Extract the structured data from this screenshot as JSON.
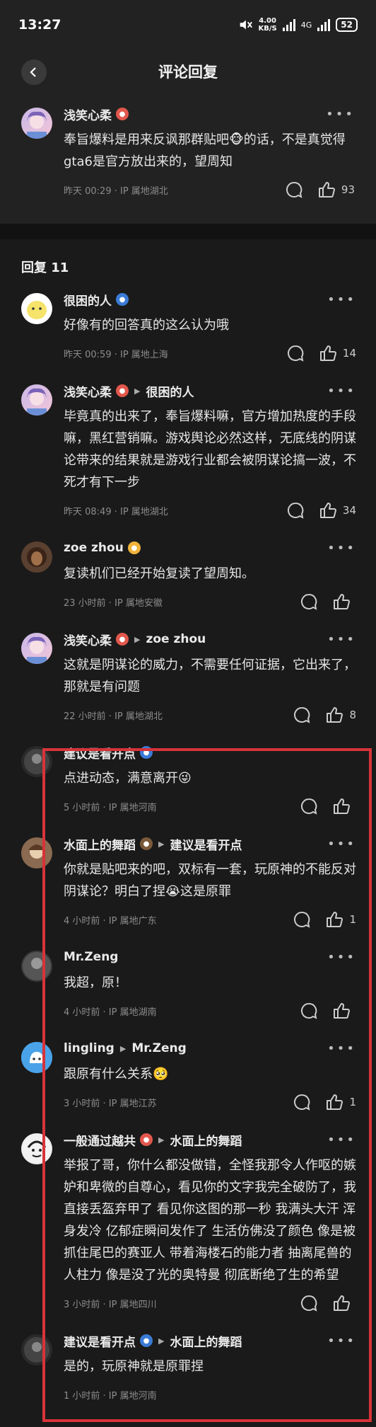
{
  "status": {
    "time": "13:27",
    "speed_top": "4.00",
    "speed_bottom": "KB/S",
    "network": "4G",
    "battery": "52"
  },
  "nav": {
    "title": "评论回复"
  },
  "op": {
    "username": "浅笑心柔",
    "text": "奉旨爆料是用来反讽那群贴吧🐵的话，不是真觉得gta6是官方放出来的，望周知",
    "meta": "昨天 00:29 · IP 属地湖北",
    "likes": "93"
  },
  "replies_header": "回复 11",
  "replies": [
    {
      "username": "很困的人",
      "reply_to": "",
      "text": "好像有的回答真的这么认为哦",
      "meta": "昨天 00:59 · IP 属地上海",
      "likes": "14"
    },
    {
      "username": "浅笑心柔",
      "reply_to": "很困的人",
      "text": "毕竟真的出来了，奉旨爆料嘛，官方增加热度的手段嘛，黑红营销嘛。游戏舆论必然这样，无底线的阴谋论带来的结果就是游戏行业都会被阴谋论搞一波，不死才有下一步",
      "meta": "昨天 08:49 · IP 属地湖北",
      "likes": "34"
    },
    {
      "username": "zoe zhou",
      "reply_to": "",
      "text": "复读机们已经开始复读了望周知。",
      "meta": "23 小时前 · IP 属地安徽",
      "likes": ""
    },
    {
      "username": "浅笑心柔",
      "reply_to": "zoe zhou",
      "text": "这就是阴谋论的威力，不需要任何证据，它出来了，那就是有问题",
      "meta": "22 小时前 · IP 属地湖北",
      "likes": "8"
    },
    {
      "username": "建议是看开点",
      "reply_to": "",
      "text": "点进动态，满意离开😜",
      "meta": "5 小时前 · IP 属地河南",
      "likes": ""
    },
    {
      "username": "水面上的舞蹈",
      "reply_to": "建议是看开点",
      "text": "你就是贴吧来的吧，双标有一套，玩原神的不能反对阴谋论？明白了捏😭这是原罪",
      "meta": "4 小时前 · IP 属地广东",
      "likes": "1"
    },
    {
      "username": "Mr.Zeng",
      "reply_to": "",
      "text": "我超，原！",
      "meta": "4 小时前 · IP 属地湖南",
      "likes": ""
    },
    {
      "username": "lingling",
      "reply_to": "Mr.Zeng",
      "text": "跟原有什么关系🥺",
      "meta": "3 小时前 · IP 属地江苏",
      "likes": "1"
    },
    {
      "username": "一般通过越共",
      "reply_to": "水面上的舞蹈",
      "text": "举报了哥，你什么都没做错，全怪我那令人作呕的嫉妒和卑微的自尊心，看见你的文字我完全破防了，我直接丢盔弃甲了 看见你这图的那一秒 我满头大汗 浑身发冷 亿郁症瞬间发作了 生活仿佛没了颜色 像是被抓住尾巴的赛亚人 带着海楼石的能力者 抽离尾兽的人柱力 像是没了光的奥特曼 彻底断绝了生的希望",
      "meta": "3 小时前 · IP 属地四川",
      "likes": ""
    },
    {
      "username": "建议是看开点",
      "reply_to": "水面上的舞蹈",
      "text": "是的，玩原神就是原罪捏",
      "meta": "1 小时前 · IP 属地河南",
      "likes": ""
    }
  ],
  "colors": {
    "background": "#1a1a1a",
    "highlight": "#d8333a",
    "meta": "#8c8c8c"
  }
}
